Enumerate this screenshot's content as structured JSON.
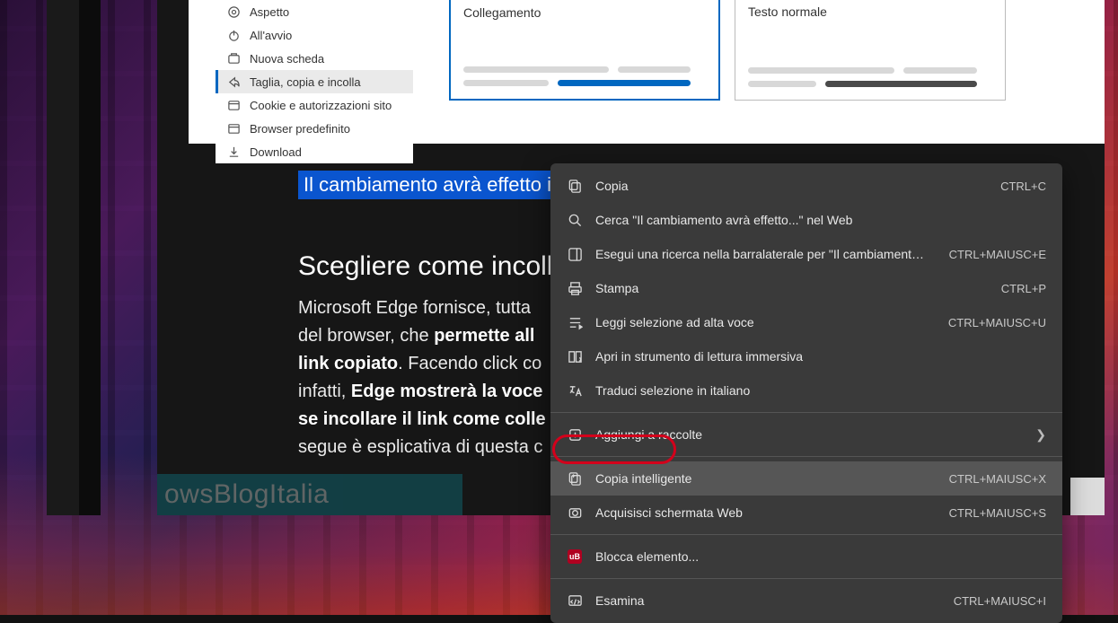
{
  "sidebar": {
    "items": [
      {
        "label": "Aspetto"
      },
      {
        "label": "All'avvio"
      },
      {
        "label": "Nuova scheda"
      },
      {
        "label": "Taglia, copia e incolla"
      },
      {
        "label": "Cookie e autorizzazioni sito"
      },
      {
        "label": "Browser predefinito"
      },
      {
        "label": "Download"
      }
    ]
  },
  "options": {
    "link": "Collegamento",
    "plain": "Testo normale"
  },
  "article": {
    "highlight": "Il cambiamento avrà effetto im",
    "heading": "Scegliere come incoll",
    "paragraph_pre": "Microsoft Edge fornisce, tutta",
    "paragraph_line2_pre": "del browser, che ",
    "paragraph_bold1": "permette all",
    "paragraph_bold2": "link copiato",
    "paragraph_after2": ". Facendo click co",
    "paragraph_line4_pre": "infatti, ",
    "paragraph_bold3": "Edge mostrerà la voce",
    "paragraph_bold4": "se incollare il link come colle",
    "paragraph_last": "segue è esplicativa di questa c"
  },
  "watermark": {
    "text_a": "ows",
    "text_b": "Blog",
    "text_c": "Italia"
  },
  "context_menu": {
    "items": [
      {
        "label": "Copia",
        "shortcut": "CTRL+C",
        "icon": "copy"
      },
      {
        "label": "Cerca \"Il cambiamento avrà effetto...\" nel Web",
        "shortcut": "",
        "icon": "search"
      },
      {
        "label": "Esegui una ricerca nella barralaterale per \"Il cambiamento avrà effetto...\"",
        "shortcut": "CTRL+MAIUSC+E",
        "icon": "side-search"
      },
      {
        "label": "Stampa",
        "shortcut": "CTRL+P",
        "icon": "print"
      },
      {
        "label": "Leggi selezione ad alta voce",
        "shortcut": "CTRL+MAIUSC+U",
        "icon": "read"
      },
      {
        "label": "Apri in strumento di lettura immersiva",
        "shortcut": "",
        "icon": "immersive"
      },
      {
        "label": "Traduci selezione in italiano",
        "shortcut": "",
        "icon": "translate"
      },
      {
        "label": "Aggiungi a raccolte",
        "shortcut": "",
        "icon": "collections",
        "submenu": true
      },
      {
        "label": "Copia intelligente",
        "shortcut": "CTRL+MAIUSC+X",
        "icon": "smart-copy",
        "highlighted": true
      },
      {
        "label": "Acquisisci schermata Web",
        "shortcut": "CTRL+MAIUSC+S",
        "icon": "capture"
      },
      {
        "label": "Blocca elemento...",
        "shortcut": "",
        "icon": "ublock"
      },
      {
        "label": "Esamina",
        "shortcut": "CTRL+MAIUSC+I",
        "icon": "inspect"
      }
    ]
  }
}
